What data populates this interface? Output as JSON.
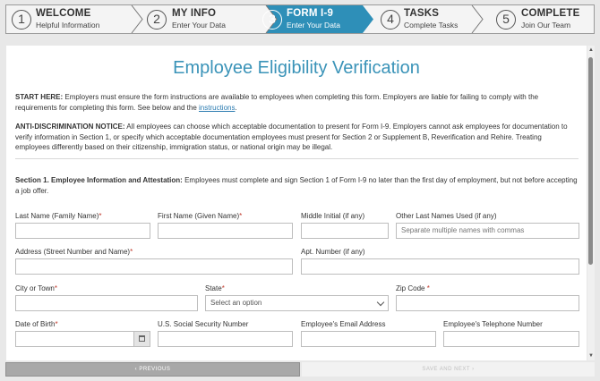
{
  "steps": [
    {
      "num": "1",
      "title": "WELCOME",
      "sub": "Helpful Information"
    },
    {
      "num": "2",
      "title": "MY INFO",
      "sub": "Enter Your Data"
    },
    {
      "num": "3",
      "title": "FORM I-9",
      "sub": "Enter Your Data"
    },
    {
      "num": "4",
      "title": "TASKS",
      "sub": "Complete Tasks"
    },
    {
      "num": "5",
      "title": "COMPLETE",
      "sub": "Join Our Team"
    }
  ],
  "active_step": 3,
  "colors": {
    "accent": "#3a93b8",
    "active_step_bg": "#2e8fb8",
    "required": "#c0392b",
    "link": "#2a7ab0"
  },
  "page_title": "Employee Eligibility Verification",
  "start_here": {
    "label": "START HERE:",
    "text": " Employers must ensure the form instructions are available to employees when completing this form. Employers are liable for failing to comply with the requirements for completing this form. See below and the ",
    "link": "instructions",
    "end": "."
  },
  "anti_discrimination": {
    "label": "ANTI-DISCRIMINATION NOTICE:",
    "text": " All employees can choose which acceptable documentation to present for Form I-9. Employers cannot ask employees for documentation to verify information in Section 1, or specify which acceptable documentation employees must present for Section 2 or Supplement B, Reverification and Rehire. Treating employees differently based on their citizenship, immigration status, or national origin may be illegal."
  },
  "section1": {
    "label": "Section 1. Employee Information and Attestation:",
    "text": " Employees must complete and sign Section 1 of Form I-9 no later than the first day of employment, but not before accepting a job offer."
  },
  "fields": {
    "last_name": {
      "label": "Last Name (Family Name)",
      "req": "*",
      "value": ""
    },
    "first_name": {
      "label": "First Name (Given Name)",
      "req": "*",
      "value": ""
    },
    "middle_initial": {
      "label": "Middle Initial (if any)",
      "value": ""
    },
    "other_last_names": {
      "label": "Other Last Names Used (if any)",
      "placeholder": "Separate multiple names with commas"
    },
    "address": {
      "label": "Address (Street Number and Name)",
      "req": "*",
      "value": ""
    },
    "apt": {
      "label": "Apt. Number (if any)",
      "value": ""
    },
    "city": {
      "label": "City or Town",
      "req": "*",
      "value": ""
    },
    "state": {
      "label": "State",
      "req": "*",
      "placeholder": "Select an option"
    },
    "zip": {
      "label": "Zip Code ",
      "req": "*",
      "value": ""
    },
    "dob": {
      "label": "Date of Birth",
      "req": "*",
      "value": ""
    },
    "ssn": {
      "label": "U.S. Social Security Number",
      "value": ""
    },
    "email": {
      "label": "Employee's Email Address",
      "value": ""
    },
    "phone": {
      "label": "Employee's Telephone Number",
      "value": ""
    }
  },
  "nav": {
    "prev": "‹   PREVIOUS",
    "next": "SAVE AND NEXT   ›"
  }
}
